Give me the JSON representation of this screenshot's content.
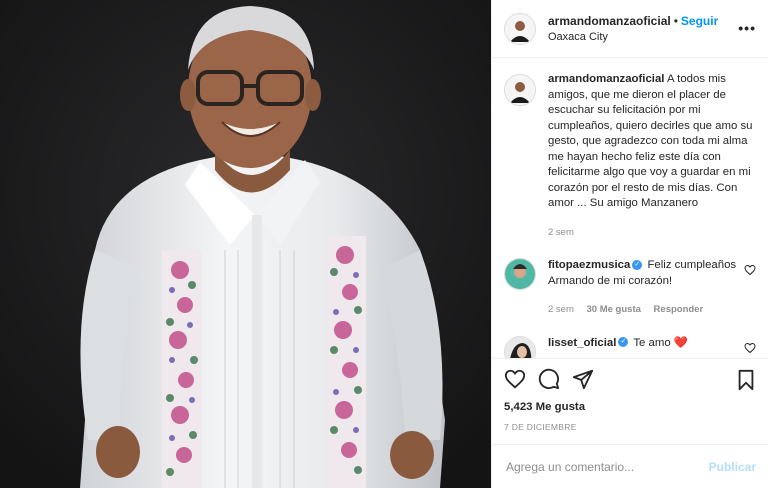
{
  "post": {
    "author": "armandomanzaoficial",
    "separator": "•",
    "follow_label": "Seguir",
    "location": "Oaxaca City",
    "more_label": "•••",
    "caption": "A todos mis amigos, que me dieron el placer de escuchar su felicitación por mi cumpleaños, quiero decirles que amo su gesto, que agradezco con toda mi alma me hayan hecho feliz este día con felicitarme algo que voy a guardar en mi corazón por el resto de mis días. Con amor ... Su amigo Manzanero",
    "caption_age": "2 sem",
    "likes": "5,423 Me gusta",
    "date": "7 DE DICIEMBRE",
    "add_comment_placeholder": "Agrega un comentario...",
    "publish_label": "Publicar"
  },
  "comments": [
    {
      "user": "fitopaezmusica",
      "text": "Feliz cumpleaños Armando de mi corazón!",
      "age": "2 sem",
      "likes": "30 Me gusta",
      "reply": "Responder"
    },
    {
      "user": "lisset_oficial",
      "text": "Te amo",
      "emoji": "❤️"
    }
  ],
  "colors": {
    "accent": "#0095f6",
    "verified": "#3897f0",
    "publish_disabled": "#b2dffc",
    "heart_red": "#ed4956"
  },
  "icons": [
    "heart-icon",
    "comment-icon",
    "share-icon",
    "bookmark-icon",
    "verified-icon",
    "more-icon"
  ]
}
